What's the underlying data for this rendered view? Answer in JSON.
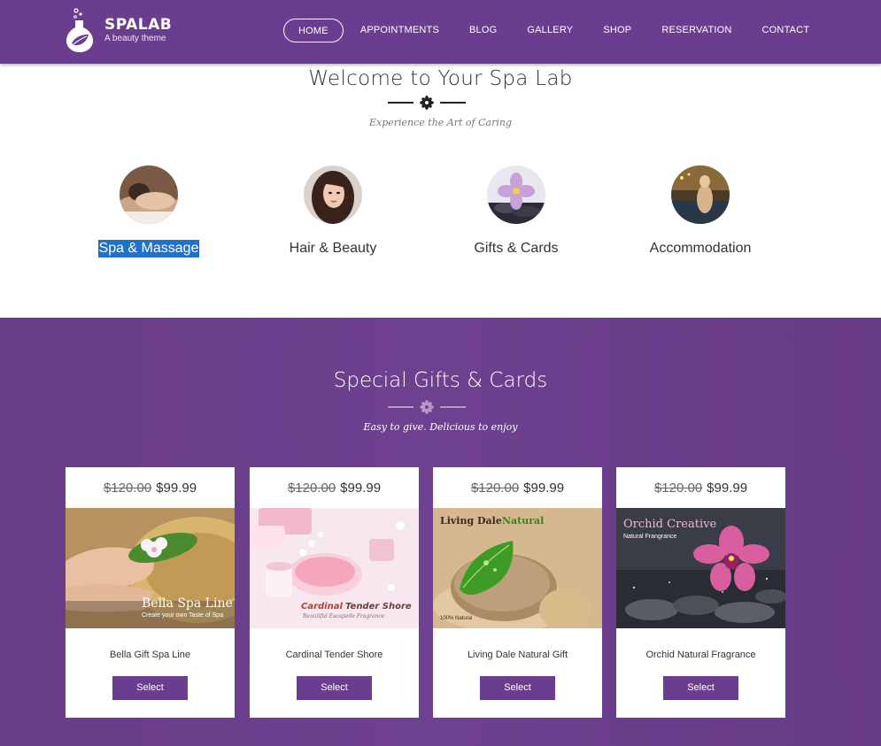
{
  "brand": {
    "name": "SPALAB",
    "tagline": "A beauty theme"
  },
  "nav": {
    "items": [
      {
        "label": "HOME",
        "active": true
      },
      {
        "label": "APPOINTMENTS"
      },
      {
        "label": "BLOG"
      },
      {
        "label": "GALLERY"
      },
      {
        "label": "SHOP"
      },
      {
        "label": "RESERVATION"
      },
      {
        "label": "CONTACT"
      }
    ]
  },
  "welcome": {
    "title": "Welcome to Your Spa Lab",
    "tagline": "Experience the Art of Caring",
    "services": [
      {
        "label": "Spa & Massage",
        "selected": true,
        "icon": "massage-photo"
      },
      {
        "label": "Hair & Beauty",
        "icon": "hair-photo"
      },
      {
        "label": "Gifts & Cards",
        "icon": "flower-photo"
      },
      {
        "label": "Accommodation",
        "icon": "pool-photo"
      }
    ]
  },
  "gifts": {
    "title": "Special Gifts & Cards",
    "tagline": "Easy to give. Delicious to enjoy",
    "cards": [
      {
        "old_price": "$120.00",
        "price": "$99.99",
        "name": "Bella Gift Spa Line",
        "button": "Select",
        "image_title": "Bella Spa Line",
        "image_subtitle": "Create your own Taste of Spa"
      },
      {
        "old_price": "$120.00",
        "price": "$99.99",
        "name": "Cardinal Tender Shore",
        "button": "Select",
        "image_title_a": "Cardinal",
        "image_title_b": "Tender Shore",
        "image_subtitle": "Beautiful Escapede Fragrance"
      },
      {
        "old_price": "$120.00",
        "price": "$99.99",
        "name": "Living Dale Natural Gift",
        "button": "Select",
        "image_title_a": "Living Dale",
        "image_title_b": "Natural",
        "image_subtitle": "100% Natural"
      },
      {
        "old_price": "$120.00",
        "price": "$99.99",
        "name": "Orchid Natural Fragrance",
        "button": "Select",
        "image_title": "Orchid Creative",
        "image_subtitle": "Natural Frangrance"
      }
    ]
  },
  "colors": {
    "brand_purple": "#6b3d8e",
    "selection_blue": "#1f72c8"
  }
}
